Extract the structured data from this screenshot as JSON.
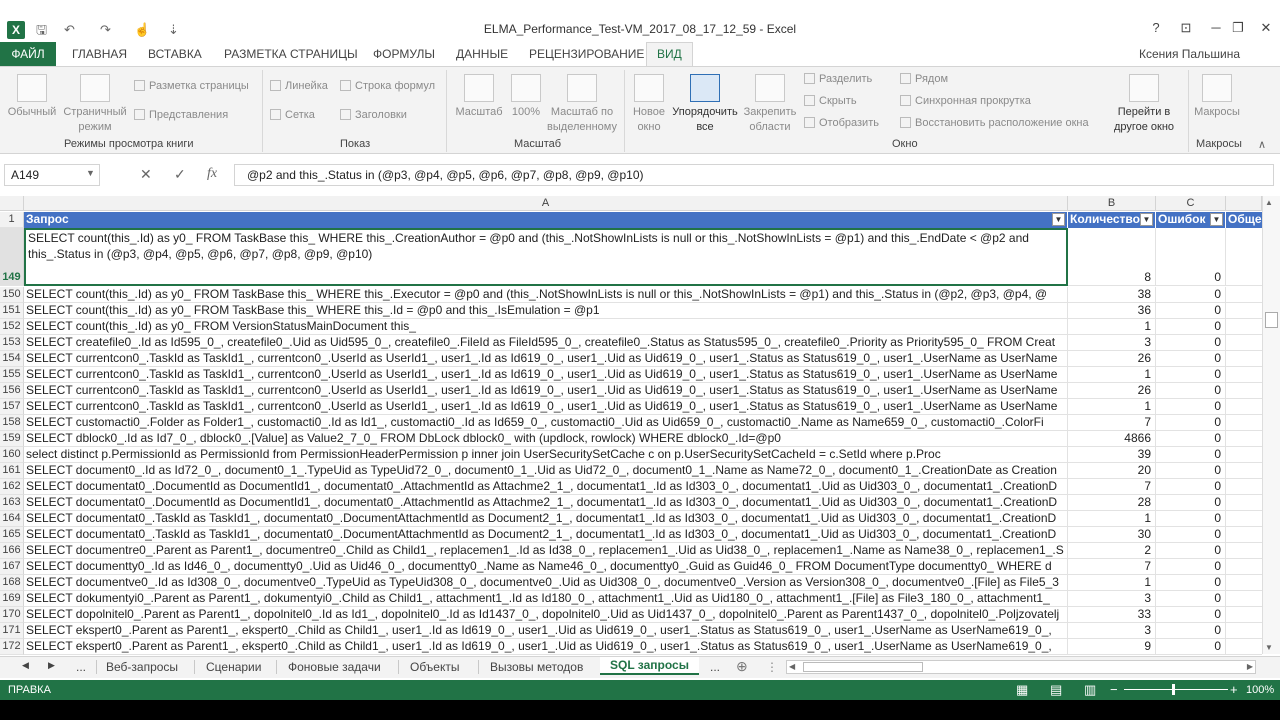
{
  "window": {
    "title": "ELMA_Performance_Test-VM_2017_08_17_12_59 - Excel",
    "user": "Ксения Пальшина",
    "controls": {
      "help": "?",
      "restore_ribbon": "⊡",
      "minimize": "─",
      "maximize": "❐",
      "close": "✕"
    }
  },
  "quick_access": {
    "save_icon": "save-icon",
    "undo_icon": "undo-icon",
    "redo_icon": "redo-icon",
    "touch_icon": "touch-icon",
    "more": "⇣"
  },
  "menu": {
    "file": "ФАЙЛ",
    "tabs": [
      "ГЛАВНАЯ",
      "ВСТАВКА",
      "РАЗМЕТКА СТРАНИЦЫ",
      "ФОРМУЛЫ",
      "ДАННЫЕ",
      "РЕЦЕНЗИРОВАНИЕ",
      "ВИД"
    ],
    "active": "ВИД"
  },
  "ribbon": {
    "views": {
      "normal": "Обычный",
      "page": "Страничный режим",
      "page_layout": "Разметка страницы",
      "custom_views": "Представления",
      "label": "Режимы просмотра книги"
    },
    "show": {
      "ruler": "Линейка",
      "formula_bar": "Строка формул",
      "gridlines": "Сетка",
      "headings": "Заголовки",
      "label": "Показ"
    },
    "zoom": {
      "zoom": "Масштаб",
      "hundred": "100%",
      "to_selection": "Масштаб по выделенному",
      "label": "Масштаб"
    },
    "window": {
      "new_window": "Новое окно",
      "arrange_all": "Упорядочить все",
      "freeze": "Закрепить области",
      "split": "Разделить",
      "hide": "Скрыть",
      "unhide": "Отобразить",
      "side_by_side": "Рядом",
      "sync_scroll": "Синхронная прокрутка",
      "reset_position": "Восстановить расположение окна",
      "switch": "Перейти в другое окно",
      "label": "Окно"
    },
    "macros": {
      "macros": "Макросы",
      "label": "Макросы"
    }
  },
  "formula_bar": {
    "name_box": "A149",
    "cancel": "✕",
    "enter": "✓",
    "fx": "fx",
    "formula": "@p2 and this_.Status in (@p3, @p4, @p5, @p6, @p7, @p8, @p9, @p10)"
  },
  "grid": {
    "columns": [
      "A",
      "B",
      "C"
    ],
    "header_row": {
      "num": "1",
      "a": "Запрос",
      "b": "Количество",
      "c": "Ошибок",
      "d": "Обще"
    },
    "row149": {
      "num": "149",
      "a1": "SELECT count(this_.Id) as y0_ FROM TaskBase this_ WHERE this_.CreationAuthor = @p0 and (this_.NotShowInLists is null or this_.NotShowInLists = @p1) and this_.EndDate < @p2 and",
      "a2": "this_.Status in (@p3, @p4, @p5, @p6, @p7, @p8, @p9, @p10)",
      "b": "8",
      "c": "0"
    },
    "rows": [
      {
        "num": "150",
        "a": "SELECT count(this_.Id) as y0_ FROM TaskBase this_ WHERE this_.Executor = @p0 and (this_.NotShowInLists is null or this_.NotShowInLists = @p1) and this_.Status in (@p2, @p3, @p4, @",
        "b": "38",
        "c": "0"
      },
      {
        "num": "151",
        "a": "SELECT count(this_.Id) as y0_ FROM TaskBase this_ WHERE this_.Id = @p0 and this_.IsEmulation = @p1",
        "b": "36",
        "c": "0"
      },
      {
        "num": "152",
        "a": "SELECT count(this_.Id) as y0_ FROM VersionStatusMainDocument this_",
        "b": "1",
        "c": "0"
      },
      {
        "num": "153",
        "a": "SELECT createfile0_.Id as Id595_0_, createfile0_.Uid as Uid595_0_, createfile0_.FileId as FileId595_0_, createfile0_.Status as Status595_0_, createfile0_.Priority as Priority595_0_ FROM Creat",
        "b": "3",
        "c": "0"
      },
      {
        "num": "154",
        "a": "SELECT currentcon0_.TaskId as TaskId1_, currentcon0_.UserId as UserId1_, user1_.Id as Id619_0_, user1_.Uid as Uid619_0_, user1_.Status as Status619_0_, user1_.UserName as UserName",
        "b": "26",
        "c": "0"
      },
      {
        "num": "155",
        "a": "SELECT currentcon0_.TaskId as TaskId1_, currentcon0_.UserId as UserId1_, user1_.Id as Id619_0_, user1_.Uid as Uid619_0_, user1_.Status as Status619_0_, user1_.UserName as UserName",
        "b": "1",
        "c": "0"
      },
      {
        "num": "156",
        "a": "SELECT currentcon0_.TaskId as TaskId1_, currentcon0_.UserId as UserId1_, user1_.Id as Id619_0_, user1_.Uid as Uid619_0_, user1_.Status as Status619_0_, user1_.UserName as UserName",
        "b": "26",
        "c": "0"
      },
      {
        "num": "157",
        "a": "SELECT currentcon0_.TaskId as TaskId1_, currentcon0_.UserId as UserId1_, user1_.Id as Id619_0_, user1_.Uid as Uid619_0_, user1_.Status as Status619_0_, user1_.UserName as UserName",
        "b": "1",
        "c": "0"
      },
      {
        "num": "158",
        "a": "SELECT customacti0_.Folder as Folder1_, customacti0_.Id as Id1_, customacti0_.Id as Id659_0_, customacti0_.Uid as Uid659_0_, customacti0_.Name as Name659_0_, customacti0_.ColorFi",
        "b": "7",
        "c": "0"
      },
      {
        "num": "159",
        "a": "SELECT dblock0_.Id as Id7_0_, dblock0_.[Value] as Value2_7_0_ FROM DbLock dblock0_ with (updlock, rowlock) WHERE dblock0_.Id=@p0",
        "b": "4866",
        "c": "0"
      },
      {
        "num": "160",
        "a": "select distinct p.PermissionId as PermissionId from PermissionHeaderPermission p             inner join UserSecuritySetCache c on p.UserSecuritySetCacheId = c.SetId             where             p.Proc",
        "b": "39",
        "c": "0"
      },
      {
        "num": "161",
        "a": "SELECT document0_.Id as Id72_0_, document0_1_.TypeUid as TypeUid72_0_, document0_1_.Uid as Uid72_0_, document0_1_.Name as Name72_0_, document0_1_.CreationDate as Creation",
        "b": "20",
        "c": "0"
      },
      {
        "num": "162",
        "a": "SELECT documentat0_.DocumentId as DocumentId1_, documentat0_.AttachmentId as Attachme2_1_, documentat1_.Id as Id303_0_, documentat1_.Uid as Uid303_0_, documentat1_.CreationD",
        "b": "7",
        "c": "0"
      },
      {
        "num": "163",
        "a": "SELECT documentat0_.DocumentId as DocumentId1_, documentat0_.AttachmentId as Attachme2_1_, documentat1_.Id as Id303_0_, documentat1_.Uid as Uid303_0_, documentat1_.CreationD",
        "b": "28",
        "c": "0"
      },
      {
        "num": "164",
        "a": "SELECT documentat0_.TaskId as TaskId1_, documentat0_.DocumentAttachmentId as Document2_1_, documentat1_.Id as Id303_0_, documentat1_.Uid as Uid303_0_, documentat1_.CreationD",
        "b": "1",
        "c": "0"
      },
      {
        "num": "165",
        "a": "SELECT documentat0_.TaskId as TaskId1_, documentat0_.DocumentAttachmentId as Document2_1_, documentat1_.Id as Id303_0_, documentat1_.Uid as Uid303_0_, documentat1_.CreationD",
        "b": "30",
        "c": "0"
      },
      {
        "num": "166",
        "a": "SELECT documentre0_.Parent as Parent1_, documentre0_.Child as Child1_, replacemen1_.Id as Id38_0_, replacemen1_.Uid as Uid38_0_, replacemen1_.Name as Name38_0_, replacemen1_.S",
        "b": "2",
        "c": "0"
      },
      {
        "num": "167",
        "a": "SELECT documentty0_.Id as Id46_0_, documentty0_.Uid as Uid46_0_, documentty0_.Name as Name46_0_, documentty0_.Guid as Guid46_0_ FROM DocumentType documentty0_ WHERE d",
        "b": "7",
        "c": "0"
      },
      {
        "num": "168",
        "a": "SELECT documentve0_.Id as Id308_0_, documentve0_.TypeUid as TypeUid308_0_, documentve0_.Uid as Uid308_0_, documentve0_.Version as Version308_0_, documentve0_.[File] as File5_3",
        "b": "1",
        "c": "0"
      },
      {
        "num": "169",
        "a": "SELECT dokumentyi0_.Parent as Parent1_, dokumentyi0_.Child as Child1_, attachment1_.Id as Id180_0_, attachment1_.Uid as Uid180_0_, attachment1_.[File] as File3_180_0_, attachment1_",
        "b": "3",
        "c": "0"
      },
      {
        "num": "170",
        "a": "SELECT dopolnitel0_.Parent as Parent1_, dopolnitel0_.Id as Id1_, dopolnitel0_.Id as Id1437_0_, dopolnitel0_.Uid as Uid1437_0_, dopolnitel0_.Parent as Parent1437_0_, dopolnitel0_.Poljzovatelj",
        "b": "33",
        "c": "0"
      },
      {
        "num": "171",
        "a": "SELECT ekspert0_.Parent as Parent1_, ekspert0_.Child as Child1_, user1_.Id as Id619_0_, user1_.Uid as Uid619_0_, user1_.Status as Status619_0_, user1_.UserName as UserName619_0_,",
        "b": "3",
        "c": "0"
      },
      {
        "num": "172",
        "a": "SELECT ekspert0_.Parent as Parent1_, ekspert0_.Child as Child1_, user1_.Id as Id619_0_, user1_.Uid as Uid619_0_, user1_.Status as Status619_0_, user1_.UserName as UserName619_0_,",
        "b": "9",
        "c": "0"
      }
    ]
  },
  "sheets": {
    "nav_prev": "◀",
    "nav_next": "▶",
    "ellipsis": "...",
    "tabs": [
      "Веб-запросы",
      "Сценарии",
      "Фоновые задачи",
      "Объекты",
      "Вызовы методов",
      "SQL запросы"
    ],
    "active": "SQL запросы",
    "more": "...",
    "add": "⊕"
  },
  "status": {
    "mode": "ПРАВКА",
    "zoom": "100%",
    "zoom_minus": "−",
    "zoom_plus": "+"
  },
  "colors": {
    "accent": "#217346",
    "table_header": "#4472c4"
  }
}
